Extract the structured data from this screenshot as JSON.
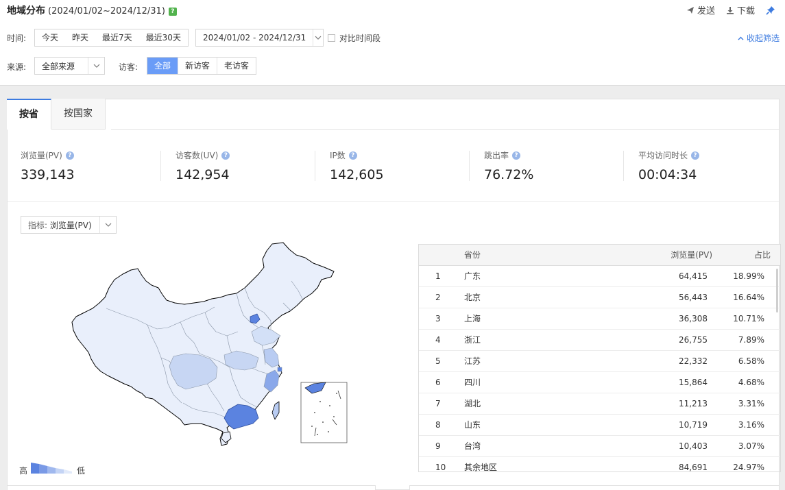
{
  "header": {
    "title": "地域分布",
    "range": "(2024/01/02~2024/12/31)",
    "help": "?",
    "actions": [
      {
        "label": "发送",
        "icon": "send-icon"
      },
      {
        "label": "下载",
        "icon": "download-icon"
      }
    ],
    "pin_icon": "pin-icon"
  },
  "filters": {
    "time_label": "时间:",
    "time_options": [
      "今天",
      "昨天",
      "最近7天",
      "最近30天"
    ],
    "date_range": "2024/01/02 - 2024/12/31",
    "compare_label": "对比时间段",
    "collapse_label": "收起筛选",
    "source_label": "来源:",
    "source_value": "全部来源",
    "visitor_label": "访客:",
    "visitor_options": [
      "全部",
      "新访客",
      "老访客"
    ],
    "visitor_selected": "全部"
  },
  "tabs": [
    "按省",
    "按国家"
  ],
  "active_tab": "按省",
  "metrics": [
    {
      "label": "浏览量(PV)",
      "value": "339,143"
    },
    {
      "label": "访客数(UV)",
      "value": "142,954"
    },
    {
      "label": "IP数",
      "value": "142,605"
    },
    {
      "label": "跳出率",
      "value": "76.72%"
    },
    {
      "label": "平均访问时长",
      "value": "00:04:34"
    }
  ],
  "indicator": {
    "label": "指标:",
    "value": "浏览量(PV)"
  },
  "table": {
    "headers": [
      "省份",
      "浏览量(PV)",
      "占比"
    ],
    "rows": [
      {
        "rank": "1",
        "province": "广东",
        "pv": "64,415",
        "pct": "18.99%"
      },
      {
        "rank": "2",
        "province": "北京",
        "pv": "56,443",
        "pct": "16.64%"
      },
      {
        "rank": "3",
        "province": "上海",
        "pv": "36,308",
        "pct": "10.71%"
      },
      {
        "rank": "4",
        "province": "浙江",
        "pv": "26,755",
        "pct": "7.89%"
      },
      {
        "rank": "5",
        "province": "江苏",
        "pv": "22,332",
        "pct": "6.58%"
      },
      {
        "rank": "6",
        "province": "四川",
        "pv": "15,864",
        "pct": "4.68%"
      },
      {
        "rank": "7",
        "province": "湖北",
        "pv": "11,213",
        "pct": "3.31%"
      },
      {
        "rank": "8",
        "province": "山东",
        "pv": "10,719",
        "pct": "3.16%"
      },
      {
        "rank": "9",
        "province": "台湾",
        "pv": "10,403",
        "pct": "3.07%"
      },
      {
        "rank": "10",
        "province": "其余地区",
        "pv": "84,691",
        "pct": "24.97%"
      }
    ]
  },
  "legend": {
    "high": "高",
    "low": "低"
  },
  "colors": {
    "accent": "#3d7be0",
    "active_button": "#6a9cf7",
    "map_base": "#e9effb",
    "map_level_1": "#5b83e0",
    "map_level_2": "#8aa8ea",
    "map_level_3": "#b9ccf2",
    "map_level_4": "#d3e0f7",
    "help_green": "#52b34d"
  }
}
